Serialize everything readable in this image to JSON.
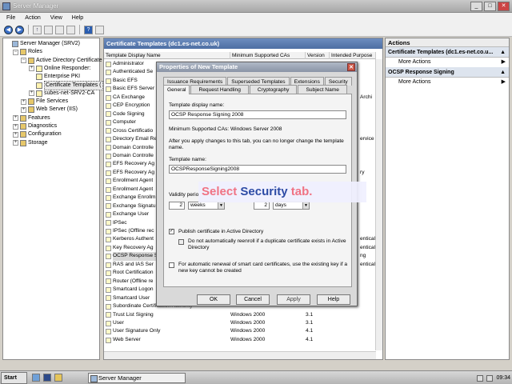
{
  "window": {
    "title": "Server Manager"
  },
  "menu": [
    "File",
    "Action",
    "View",
    "Help"
  ],
  "toolbar": {
    "back": "◀",
    "forward": "▶",
    "up": "↑",
    "help": "?"
  },
  "tree": [
    {
      "label": "Server Manager (SRV2)",
      "level": 0,
      "toggle": "",
      "icon": "server"
    },
    {
      "label": "Roles",
      "level": 1,
      "toggle": "−",
      "icon": "folder"
    },
    {
      "label": "Active Directory Certificate",
      "level": 2,
      "toggle": "−",
      "icon": "folder"
    },
    {
      "label": "Online Responder:",
      "level": 3,
      "toggle": "+",
      "icon": "cert"
    },
    {
      "label": "Enterprise PKI",
      "level": 3,
      "toggle": "",
      "icon": "cert"
    },
    {
      "label": "Certificate Templates (",
      "level": 3,
      "toggle": "",
      "icon": "cert",
      "selected": true
    },
    {
      "label": "subes-net-SRV2-CA",
      "level": 3,
      "toggle": "+",
      "icon": "cert"
    },
    {
      "label": "File Services",
      "level": 2,
      "toggle": "+",
      "icon": "folder"
    },
    {
      "label": "Web Server (IIS)",
      "level": 2,
      "toggle": "+",
      "icon": "folder"
    },
    {
      "label": "Features",
      "level": 1,
      "toggle": "+",
      "icon": "folder"
    },
    {
      "label": "Diagnostics",
      "level": 1,
      "toggle": "+",
      "icon": "folder"
    },
    {
      "label": "Configuration",
      "level": 1,
      "toggle": "+",
      "icon": "folder"
    },
    {
      "label": "Storage",
      "level": 1,
      "toggle": "+",
      "icon": "folder"
    }
  ],
  "middle": {
    "header": "Certificate Templates (dc1.es-net.co.uk)",
    "columns": [
      "Template Display Name",
      "Minimum Supported CAs",
      "Version",
      "Intended Purpose"
    ],
    "rows": [
      {
        "name": "Administrator",
        "ca": "",
        "ver": ""
      },
      {
        "name": "Authenticated Se",
        "ca": "",
        "ver": ""
      },
      {
        "name": "Basic EFS",
        "ca": "",
        "ver": ""
      },
      {
        "name": "Basic EFS Server",
        "ca": "",
        "ver": ""
      },
      {
        "name": "CA Exchange",
        "ca": "",
        "ver": ""
      },
      {
        "name": "CEP Encryption",
        "ca": "",
        "ver": ""
      },
      {
        "name": "Code Signing",
        "ca": "",
        "ver": ""
      },
      {
        "name": "Computer",
        "ca": "",
        "ver": ""
      },
      {
        "name": "Cross Certificatio",
        "ca": "",
        "ver": ""
      },
      {
        "name": "Directory Email Re",
        "ca": "",
        "ver": ""
      },
      {
        "name": "Domain Controlle",
        "ca": "",
        "ver": ""
      },
      {
        "name": "Domain Controlle",
        "ca": "",
        "ver": ""
      },
      {
        "name": "EFS Recovery Ag",
        "ca": "",
        "ver": ""
      },
      {
        "name": "EFS Recovery Ag",
        "ca": "",
        "ver": ""
      },
      {
        "name": "Enrollment Agent",
        "ca": "",
        "ver": ""
      },
      {
        "name": "Enrollment Agent",
        "ca": "",
        "ver": ""
      },
      {
        "name": "Exchange Enrollm",
        "ca": "",
        "ver": ""
      },
      {
        "name": "Exchange Signatu",
        "ca": "",
        "ver": ""
      },
      {
        "name": "Exchange User",
        "ca": "",
        "ver": ""
      },
      {
        "name": "IPSec",
        "ca": "",
        "ver": ""
      },
      {
        "name": "IPSec (Offline rec",
        "ca": "",
        "ver": ""
      },
      {
        "name": "Kerberos Authent",
        "ca": "",
        "ver": ""
      },
      {
        "name": "Key Recovery Ag",
        "ca": "",
        "ver": ""
      },
      {
        "name": "OCSP Response S",
        "ca": "",
        "ver": "",
        "highlight": true
      },
      {
        "name": "RAS and IAS Ser",
        "ca": "",
        "ver": ""
      },
      {
        "name": "Root Certification",
        "ca": "",
        "ver": ""
      },
      {
        "name": "Router (Offline re",
        "ca": "",
        "ver": ""
      },
      {
        "name": "Smartcard Logon",
        "ca": "",
        "ver": ""
      },
      {
        "name": "Smartcard User",
        "ca": "",
        "ver": ""
      },
      {
        "name": "Subordinate Certification Authority",
        "ca": "",
        "ver": ""
      },
      {
        "name": "Trust List Signing",
        "ca": "Windows 2000",
        "ver": "3.1"
      },
      {
        "name": "User",
        "ca": "Windows 2000",
        "ver": "3.1"
      },
      {
        "name": "User Signature Only",
        "ca": "Windows 2000",
        "ver": "4.1"
      },
      {
        "name": "Web Server",
        "ca": "Windows 2000",
        "ver": "4.1"
      }
    ],
    "right_fragments": [
      "Archi",
      "ervice",
      "ry",
      "entical",
      "entical",
      "ng",
      "entical"
    ]
  },
  "actions": {
    "header": "Actions",
    "sections": [
      {
        "title": "Certificate Templates (dc1.es-net.co.u...",
        "items": [
          "More Actions"
        ]
      },
      {
        "title": "OCSP Response Signing",
        "items": [
          "More Actions"
        ]
      }
    ]
  },
  "dialog": {
    "title": "Properties of New Template",
    "tabs_back": [
      "Issuance Requirements",
      "Superseded Templates",
      "Extensions",
      "Security"
    ],
    "tabs_front": [
      "General",
      "Request Handling",
      "Cryptography",
      "Subject Name"
    ],
    "display_name_label": "Template display name:",
    "display_name_value": "OCSP Response Signing 2008",
    "min_ca_text": "Minimum Supported CAs:   Windows Server 2008",
    "note": "After you apply changes to this tab, you can no longer change the template name.",
    "template_name_label": "Template name:",
    "template_name_value": "OCSPResponseSigning2008",
    "validity_label": "Validity perio",
    "validity_value": "2",
    "validity_unit": "weeks",
    "renewal_value": "2",
    "renewal_unit": "days",
    "publish_label": "Publish certificate in Active Directory",
    "publish_checked": "✓",
    "no_reenroll_label": "Do not automatically reenroll if a duplicate certificate exists in Active Directory",
    "smartcard_label": "For automatic renewal of smart card certificates, use the existing key if a new key cannot be created",
    "buttons": [
      "OK",
      "Cancel",
      "Apply",
      "Help"
    ]
  },
  "callout": {
    "part1": "Select ",
    "part2": "Security",
    "part3": " tab."
  },
  "taskbar": {
    "start": "Start",
    "task": "Server Manager",
    "clock": "09:34"
  }
}
